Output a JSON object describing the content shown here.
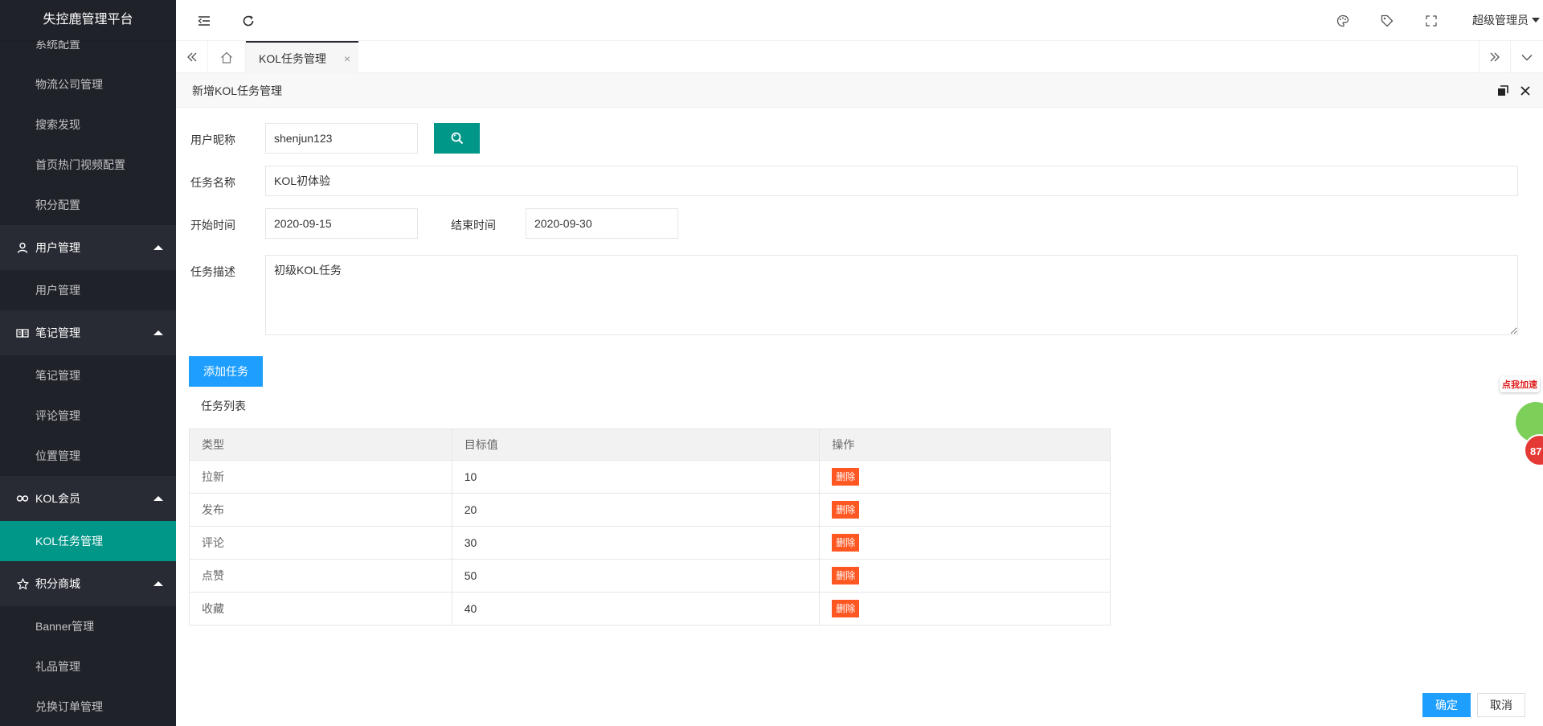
{
  "app": {
    "title": "失控鹿管理平台"
  },
  "sidebar": {
    "items": [
      {
        "label": "系统配置"
      },
      {
        "label": "物流公司管理"
      },
      {
        "label": "搜索发现"
      },
      {
        "label": "首页热门视频配置"
      },
      {
        "label": "积分配置"
      }
    ],
    "groups": [
      {
        "label": "用户管理",
        "icon": "user-icon",
        "children": [
          {
            "label": "用户管理"
          }
        ]
      },
      {
        "label": "笔记管理",
        "icon": "book-icon",
        "children": [
          {
            "label": "笔记管理"
          },
          {
            "label": "评论管理"
          },
          {
            "label": "位置管理"
          }
        ]
      },
      {
        "label": "KOL会员",
        "icon": "link-icon",
        "children": [
          {
            "label": "KOL任务管理"
          }
        ]
      },
      {
        "label": "积分商城",
        "icon": "star-icon",
        "children": [
          {
            "label": "Banner管理"
          },
          {
            "label": "礼品管理"
          },
          {
            "label": "兑换订单管理"
          }
        ]
      }
    ],
    "active_item": "KOL任务管理",
    "accent_color": "#009688"
  },
  "header": {
    "user": "超级管理员"
  },
  "tabs": [
    {
      "label": "KOL任务管理",
      "close": "×"
    }
  ],
  "dialog": {
    "title": "新增KOL任务管理",
    "form": {
      "nickname_label": "用户昵称",
      "nickname_value": "shenjun123",
      "task_name_label": "任务名称",
      "task_name_value": "KOL初体验",
      "start_label": "开始时间",
      "start_value": "2020-09-15",
      "end_label": "结束时间",
      "end_value": "2020-09-30",
      "desc_label": "任务描述",
      "desc_value": "初级KOL任务"
    },
    "add_button": "添加任务",
    "list_title": "任务列表",
    "table": {
      "headers": [
        "类型",
        "目标值",
        "操作"
      ],
      "rows": [
        {
          "type": "拉新",
          "target": "10",
          "action": "删除"
        },
        {
          "type": "发布",
          "target": "20",
          "action": "删除"
        },
        {
          "type": "评论",
          "target": "30",
          "action": "删除"
        },
        {
          "type": "点赞",
          "target": "50",
          "action": "删除"
        },
        {
          "type": "收藏",
          "target": "40",
          "action": "删除"
        }
      ]
    },
    "ok_button": "确定",
    "cancel_button": "取消"
  },
  "floating_widget": {
    "label": "点我加速",
    "badge": "87"
  }
}
